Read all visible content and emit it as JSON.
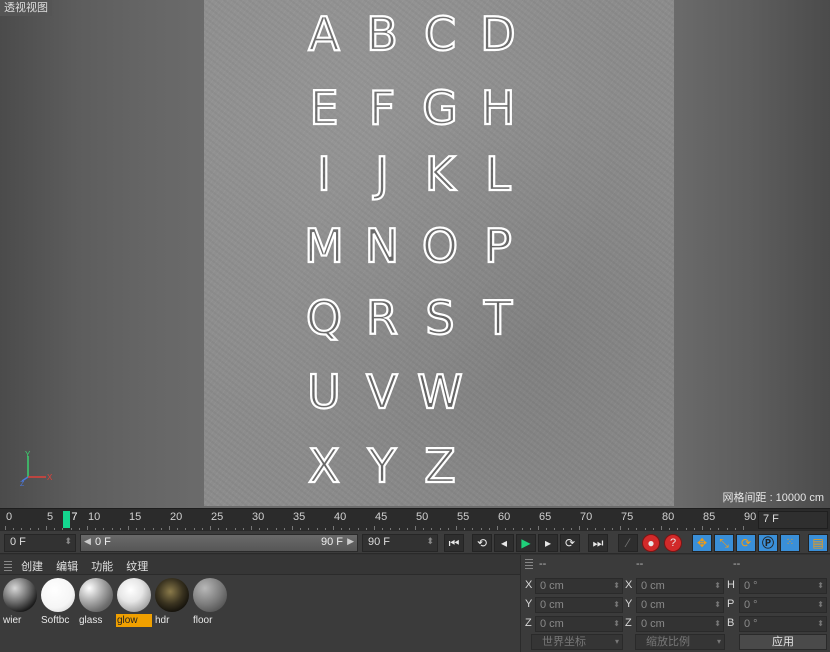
{
  "viewport": {
    "title": "透视视图",
    "grid_spacing": "网格间距 : 10000 cm",
    "axis": {
      "x": "X",
      "y": "Y",
      "z": "Z"
    },
    "letters": [
      "A",
      "B",
      "C",
      "D",
      "E",
      "F",
      "G",
      "H",
      "I",
      "J",
      "K",
      "L",
      "M",
      "N",
      "O",
      "P",
      "Q",
      "R",
      "S",
      "T",
      "U",
      "V",
      "W",
      "X",
      "Y",
      "Z"
    ]
  },
  "timeline": {
    "ticks": [
      "0",
      "5",
      "10",
      "15",
      "20",
      "25",
      "30",
      "35",
      "40",
      "45",
      "50",
      "55",
      "60",
      "65",
      "70",
      "75",
      "80",
      "85",
      "90"
    ],
    "playhead_label": "7",
    "current_frame": "7 F"
  },
  "transport": {
    "start_field": "0 F",
    "range_start": "0 F",
    "range_end": "90 F",
    "end_field": "90 F"
  },
  "materials": {
    "menu": [
      "创建",
      "编辑",
      "功能",
      "纹理"
    ],
    "items": [
      {
        "name": "wier"
      },
      {
        "name": "Softbc"
      },
      {
        "name": "glass"
      },
      {
        "name": "glow"
      },
      {
        "name": "hdr"
      },
      {
        "name": "floor"
      }
    ]
  },
  "coordinates": {
    "headers": [
      "--",
      "--",
      "--"
    ],
    "rows": [
      {
        "l1": "X",
        "v1": "0 cm",
        "l2": "X",
        "v2": "0 cm",
        "l3": "H",
        "v3": "0 °"
      },
      {
        "l1": "Y",
        "v1": "0 cm",
        "l2": "Y",
        "v2": "0 cm",
        "l3": "P",
        "v3": "0 °"
      },
      {
        "l1": "Z",
        "v1": "0 cm",
        "l2": "Z",
        "v2": "0 cm",
        "l3": "B",
        "v3": "0 °"
      }
    ],
    "world_coord": "世界坐标",
    "scale_mode": "缩放比例",
    "apply": "应用"
  },
  "colors": {
    "playhead": "#14d68f",
    "selected_material": "#f0a000",
    "play_green": "#1fd07a",
    "record_red": "#d22a2a",
    "tool_orange": "#f39c12",
    "tool_blue": "#3a8fd8"
  }
}
